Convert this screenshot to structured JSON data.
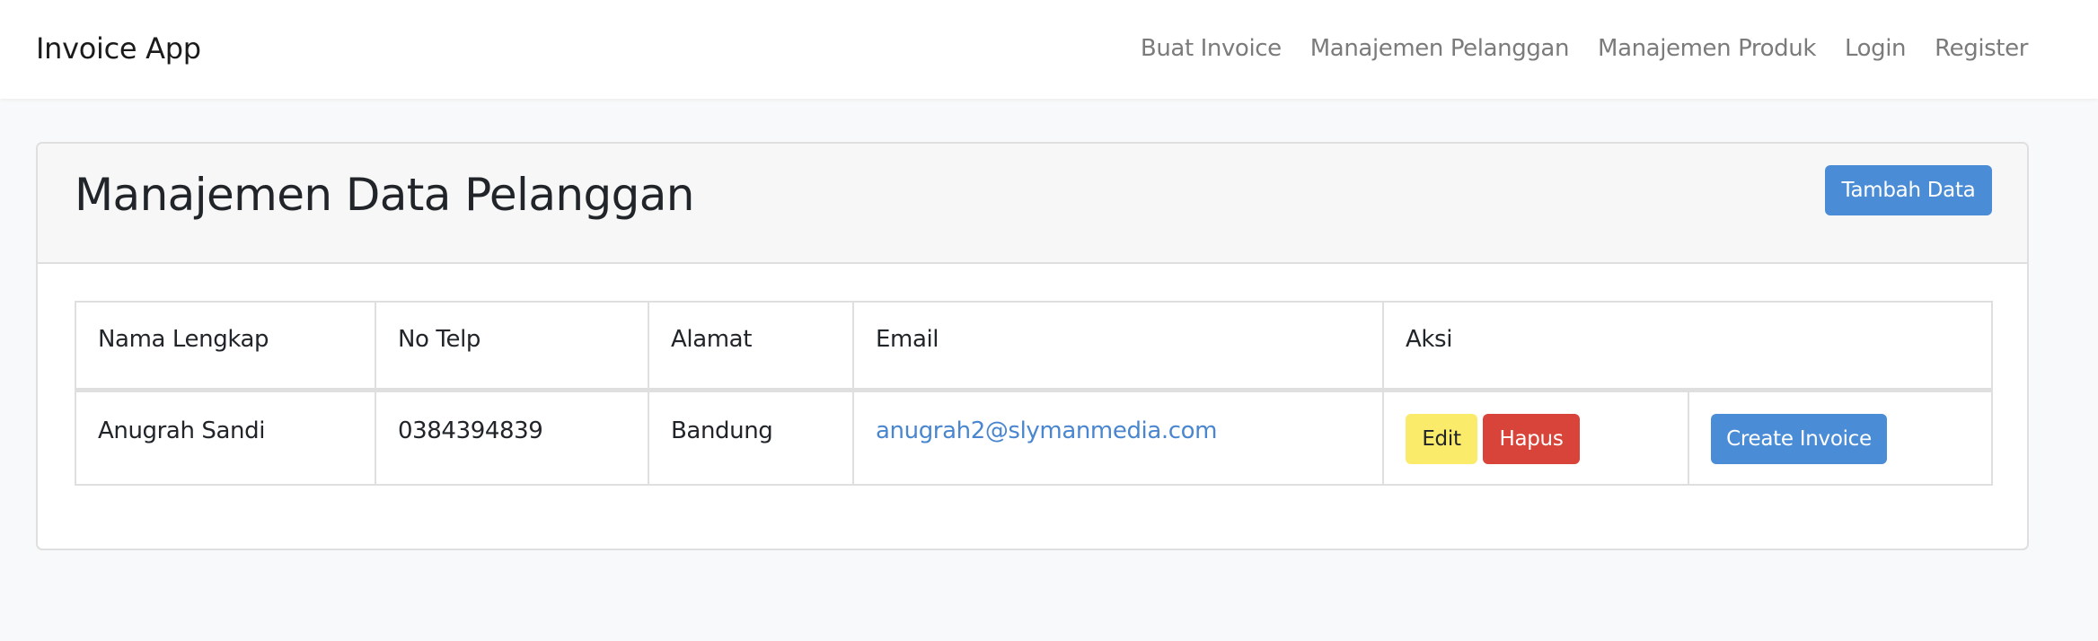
{
  "navbar": {
    "brand": "Invoice App",
    "links": [
      {
        "label": "Buat Invoice"
      },
      {
        "label": "Manajemen Pelanggan"
      },
      {
        "label": "Manajemen Produk"
      },
      {
        "label": "Login"
      },
      {
        "label": "Register"
      }
    ]
  },
  "card": {
    "title": "Manajemen Data Pelanggan",
    "add_button": "Tambah Data"
  },
  "table": {
    "headers": [
      "Nama Lengkap",
      "No Telp",
      "Alamat",
      "Email",
      "Aksi"
    ],
    "rows": [
      {
        "nama": "Anugrah Sandi",
        "telp": "0384394839",
        "alamat": "Bandung",
        "email": "anugrah2@slymanmedia.com",
        "edit_label": "Edit",
        "delete_label": "Hapus",
        "invoice_label": "Create Invoice"
      }
    ]
  },
  "colors": {
    "primary": "#4a8cd6",
    "warning": "#fbeb6a",
    "danger": "#d9443a",
    "link": "#4a86cf"
  }
}
